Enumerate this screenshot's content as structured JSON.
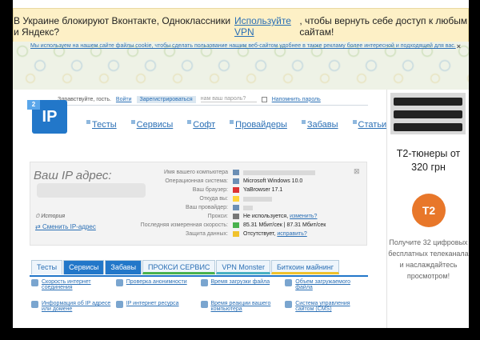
{
  "banner": {
    "text_before": "В Украине блокируют Вконтакте, Одноклассники и Яндекс?",
    "link": "Используйте VPN",
    "text_after": ", чтобы вернуть себе доступ к любым сайтам!"
  },
  "cookie": {
    "text": "Мы используем на нашем сайте файлы cookie, чтобы сделать пользование нашим веб-сайтом удобнее в также рекламу более интересной и подходящей для вас.",
    "close": "×"
  },
  "topbar": {
    "greeting": "Здравствуйте, гость.",
    "login": "Войти",
    "register": "Зарегистрироваться",
    "password_placeholder": "нам ваш пароль?",
    "remember": "Напомнить пароль"
  },
  "logo": {
    "text": "IP",
    "badge": "2"
  },
  "nav": [
    "Тесты",
    "Сервисы",
    "Софт",
    "Провайдеры",
    "Забавы",
    "Статьи"
  ],
  "ip_panel": {
    "title": "Ваш IP адрес:",
    "history": "История",
    "change_ip": "Сменить IP-адрес",
    "rows": [
      {
        "key": "Имя вашего компьютера",
        "value": ""
      },
      {
        "key": "Операционная система:",
        "value": "Microsoft Windows 10.0"
      },
      {
        "key": "Ваш браузер:",
        "value": "YaBrowser 17.1"
      },
      {
        "key": "Откуда вы:",
        "value": ""
      },
      {
        "key": "Ваш провайдер:",
        "value": ""
      },
      {
        "key": "Прокси:",
        "value": "Не используется,",
        "link": "изменить?"
      },
      {
        "key": "Последняя измеренная скорость:",
        "value": "85.31 Мбит/сек | 87.31 Мбит/сек"
      },
      {
        "key": "Защита данных:",
        "value": "Отсутствует,",
        "link": "исправить?"
      }
    ]
  },
  "tabs": [
    "Тесты",
    "Сервисы",
    "Забавы",
    "ПРОКСИ СЕРВИС",
    "VPN Monster",
    "Биткоин майнинг"
  ],
  "tools": [
    [
      "Скорость интернет соединения",
      "Проверка анонимности",
      "Время загрузки файла",
      "Объем загружаемого файла"
    ],
    [
      "Информация об IP адресе или домене",
      "IP интернет ресурса",
      "Время реакции вашего компьютера",
      "Система управления сайтом (CMS)"
    ]
  ],
  "ad": {
    "title": "T2-тюнеры от 320 грн",
    "logo": "T2",
    "text": "Получите 32 цифровых бесплатных телеканала и наслаждайтесь просмотром!"
  },
  "colors": {
    "accent": "#2277c9",
    "link": "#2a6fb5",
    "ad_accent": "#e8772a"
  }
}
